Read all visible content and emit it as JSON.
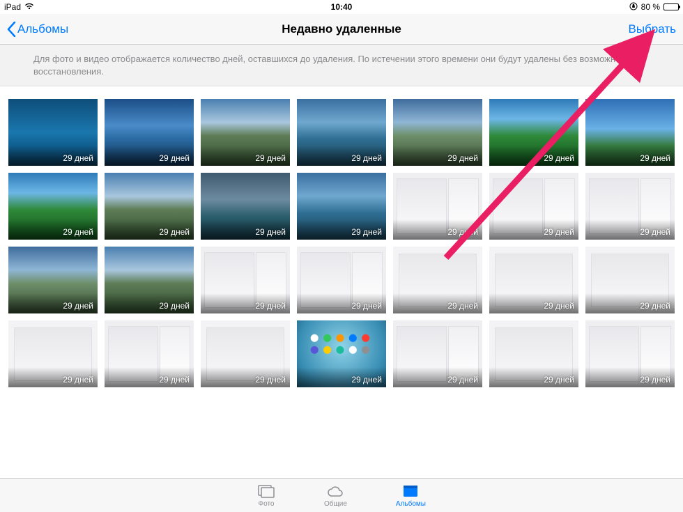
{
  "status": {
    "device": "iPad",
    "time": "10:40",
    "battery_pct": "80 %"
  },
  "nav": {
    "back_label": "Альбомы",
    "title": "Недавно удаленные",
    "select_label": "Выбрать"
  },
  "info_text": "Для фото и видео отображается количество дней, оставшихся до удаления. По истечении этого времени они будут удалены без возможности восстановления.",
  "days_label": "29 дней",
  "thumbs": [
    {
      "kind": "beach"
    },
    {
      "kind": "sky2"
    },
    {
      "kind": "mtn"
    },
    {
      "kind": "lake"
    },
    {
      "kind": "mtn2"
    },
    {
      "kind": "green"
    },
    {
      "kind": "sky"
    },
    {
      "kind": "green"
    },
    {
      "kind": "mtn"
    },
    {
      "kind": "storm"
    },
    {
      "kind": "lake"
    },
    {
      "kind": "shot2"
    },
    {
      "kind": "shot2"
    },
    {
      "kind": "shot2"
    },
    {
      "kind": "mtn2"
    },
    {
      "kind": "mtn"
    },
    {
      "kind": "shot2"
    },
    {
      "kind": "shot2"
    },
    {
      "kind": "shot"
    },
    {
      "kind": "shot"
    },
    {
      "kind": "shot"
    },
    {
      "kind": "shot"
    },
    {
      "kind": "shot2"
    },
    {
      "kind": "shot"
    },
    {
      "kind": "home"
    },
    {
      "kind": "shot2"
    },
    {
      "kind": "shot"
    },
    {
      "kind": "shot2"
    }
  ],
  "tabs": {
    "photos": "Фото",
    "shared": "Общие",
    "albums": "Альбомы"
  }
}
